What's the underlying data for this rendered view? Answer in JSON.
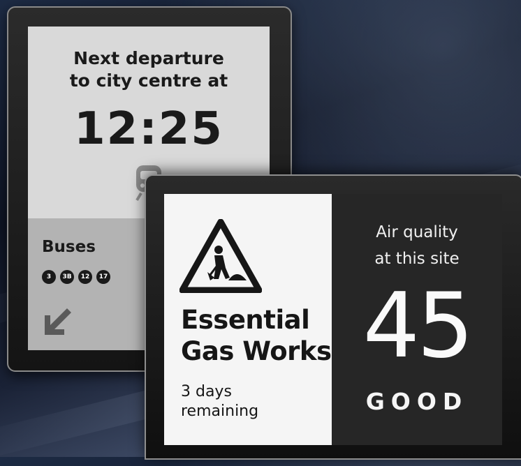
{
  "departure_display": {
    "heading_line1": "Next departure",
    "heading_line2": "to city centre at",
    "time": "12:25",
    "train_icon": "train-icon",
    "buses_label": "Buses",
    "routes": [
      "3",
      "3B",
      "12",
      "17"
    ],
    "direction_icon": "arrow-down-left-icon"
  },
  "info_display": {
    "warning_icon": "road-works-warning-icon",
    "notice_line1": "Essential",
    "notice_line2": "Gas Works",
    "remaining_line1": "3 days",
    "remaining_line2": "remaining",
    "air_quality_line1": "Air quality",
    "air_quality_line2": "at this site",
    "air_quality_value": "45",
    "air_quality_rating": "GOOD"
  }
}
